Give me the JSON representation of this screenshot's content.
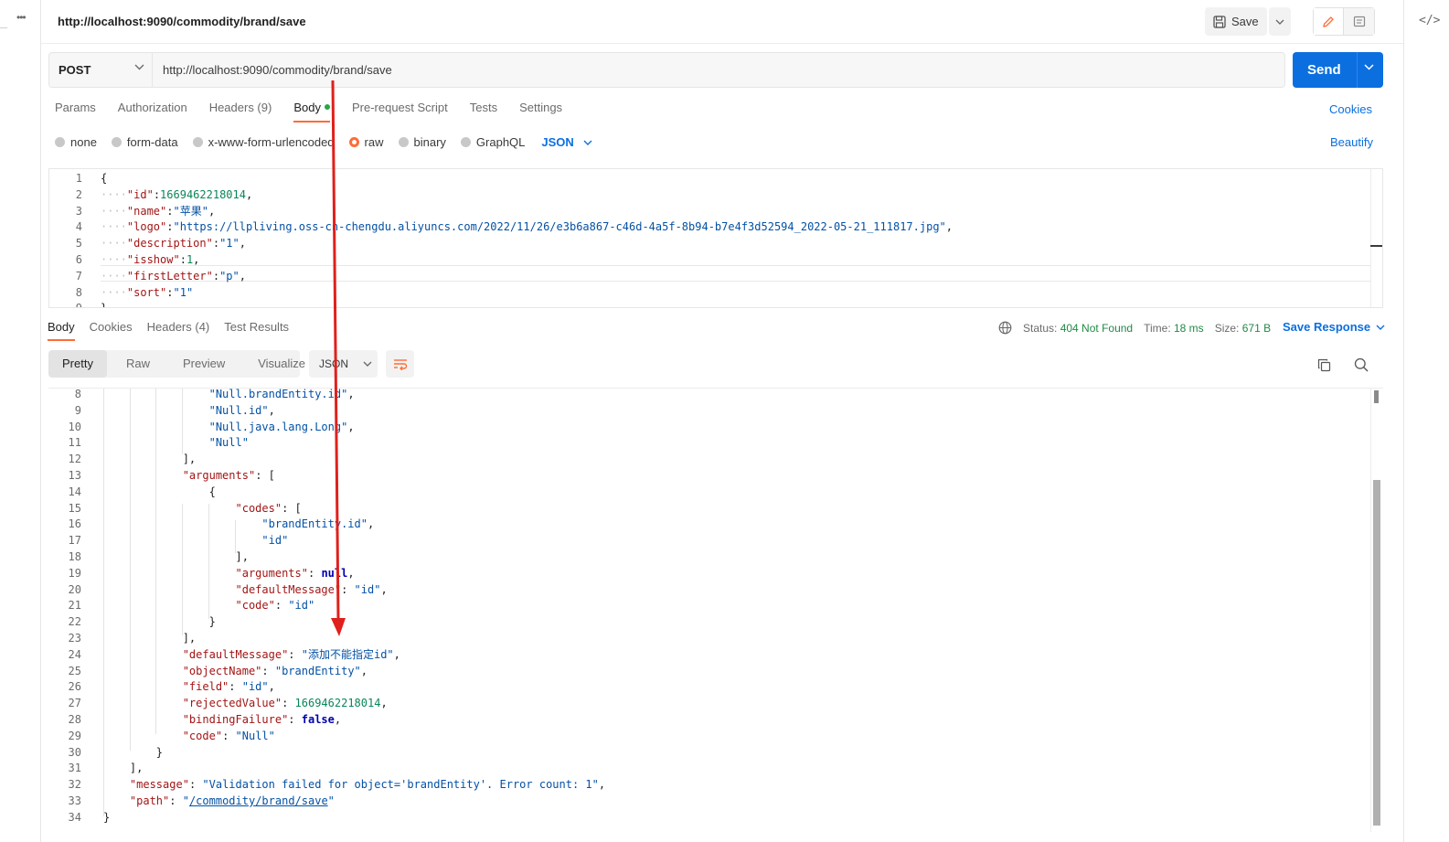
{
  "tab": {
    "title": "http://localhost:9090/commodity/brand/save",
    "save_label": "Save"
  },
  "request": {
    "method": "POST",
    "url": "http://localhost:9090/commodity/brand/save",
    "send_label": "Send",
    "tabs": [
      {
        "label": "Params"
      },
      {
        "label": "Authorization"
      },
      {
        "label": "Headers (9)"
      },
      {
        "label": "Body"
      },
      {
        "label": "Pre-request Script"
      },
      {
        "label": "Tests"
      },
      {
        "label": "Settings"
      }
    ],
    "cookies_label": "Cookies",
    "body_types": [
      "none",
      "form-data",
      "x-www-form-urlencoded",
      "raw",
      "binary",
      "GraphQL"
    ],
    "selected_body_type": "raw",
    "format": "JSON",
    "beautify_label": "Beautify",
    "body_lines": [
      {
        "n": "1",
        "text": "{"
      },
      {
        "n": "2",
        "ind": "····",
        "key": "\"id\"",
        "sep": ":",
        "val": "1669462218014",
        "vt": "n",
        "end": ","
      },
      {
        "n": "3",
        "ind": "····",
        "key": "\"name\"",
        "sep": ":",
        "val": "\"苹果\"",
        "vt": "s",
        "end": ","
      },
      {
        "n": "4",
        "ind": "····",
        "key": "\"logo\"",
        "sep": ":",
        "val": "\"https://llpliving.oss-cn-chengdu.aliyuncs.com/2022/11/26/e3b6a867-c46d-4a5f-8b94-b7e4f3d52594_2022-05-21_111817.jpg\"",
        "vt": "s",
        "end": ","
      },
      {
        "n": "5",
        "ind": "····",
        "key": "\"description\"",
        "sep": ":",
        "val": "\"1\"",
        "vt": "s",
        "end": ","
      },
      {
        "n": "6",
        "ind": "····",
        "key": "\"isshow\"",
        "sep": ":",
        "val": "1",
        "vt": "n",
        "end": ","
      },
      {
        "n": "7",
        "ind": "····",
        "key": "\"firstLetter\"",
        "sep": ":",
        "val": "\"p\"",
        "vt": "s",
        "end": ","
      },
      {
        "n": "8",
        "ind": "····",
        "key": "\"sort\"",
        "sep": ":",
        "val": "\"1\"",
        "vt": "s",
        "end": ""
      },
      {
        "n": "9",
        "text": "}"
      }
    ]
  },
  "response": {
    "tabs": [
      {
        "label": "Body"
      },
      {
        "label": "Cookies"
      },
      {
        "label": "Headers (4)"
      },
      {
        "label": "Test Results"
      }
    ],
    "status_label": "Status:",
    "status_value": "404 Not Found",
    "time_label": "Time:",
    "time_value": "18 ms",
    "size_label": "Size:",
    "size_value": "671 B",
    "save_response_label": "Save Response",
    "views": [
      "Pretty",
      "Raw",
      "Preview",
      "Visualize"
    ],
    "format": "JSON",
    "lines": [
      {
        "n": "8",
        "ind": "                ",
        "val": "\"Null.brandEntity.id\"",
        "vt": "s",
        "end": ","
      },
      {
        "n": "9",
        "ind": "                ",
        "val": "\"Null.id\"",
        "vt": "s",
        "end": ","
      },
      {
        "n": "10",
        "ind": "                ",
        "val": "\"Null.java.lang.Long\"",
        "vt": "s",
        "end": ","
      },
      {
        "n": "11",
        "ind": "                ",
        "val": "\"Null\"",
        "vt": "s",
        "end": ""
      },
      {
        "n": "12",
        "ind": "            ",
        "text": "],",
        "vt": "p"
      },
      {
        "n": "13",
        "ind": "            ",
        "key": "\"arguments\"",
        "sep": ": ",
        "text2": "["
      },
      {
        "n": "14",
        "ind": "                ",
        "text": "{",
        "vt": "p"
      },
      {
        "n": "15",
        "ind": "                    ",
        "key": "\"codes\"",
        "sep": ": ",
        "text2": "["
      },
      {
        "n": "16",
        "ind": "                        ",
        "val": "\"brandEntity.id\"",
        "vt": "s",
        "end": ","
      },
      {
        "n": "17",
        "ind": "                        ",
        "val": "\"id\"",
        "vt": "s",
        "end": ""
      },
      {
        "n": "18",
        "ind": "                    ",
        "text": "],",
        "vt": "p"
      },
      {
        "n": "19",
        "ind": "                    ",
        "key": "\"arguments\"",
        "sep": ": ",
        "val": "null",
        "vt": "b",
        "end": ","
      },
      {
        "n": "20",
        "ind": "                    ",
        "key": "\"defaultMessage\"",
        "sep": ": ",
        "val": "\"id\"",
        "vt": "s",
        "end": ","
      },
      {
        "n": "21",
        "ind": "                    ",
        "key": "\"code\"",
        "sep": ": ",
        "val": "\"id\"",
        "vt": "s",
        "end": ""
      },
      {
        "n": "22",
        "ind": "                ",
        "text": "}",
        "vt": "p"
      },
      {
        "n": "23",
        "ind": "            ",
        "text": "],",
        "vt": "p"
      },
      {
        "n": "24",
        "ind": "            ",
        "key": "\"defaultMessage\"",
        "sep": ": ",
        "val": "\"添加不能指定id\"",
        "vt": "s",
        "end": ","
      },
      {
        "n": "25",
        "ind": "            ",
        "key": "\"objectName\"",
        "sep": ": ",
        "val": "\"brandEntity\"",
        "vt": "s",
        "end": ","
      },
      {
        "n": "26",
        "ind": "            ",
        "key": "\"field\"",
        "sep": ": ",
        "val": "\"id\"",
        "vt": "s",
        "end": ","
      },
      {
        "n": "27",
        "ind": "            ",
        "key": "\"rejectedValue\"",
        "sep": ": ",
        "val": "1669462218014",
        "vt": "n",
        "end": ","
      },
      {
        "n": "28",
        "ind": "            ",
        "key": "\"bindingFailure\"",
        "sep": ": ",
        "val": "false",
        "vt": "b",
        "end": ","
      },
      {
        "n": "29",
        "ind": "            ",
        "key": "\"code\"",
        "sep": ": ",
        "val": "\"Null\"",
        "vt": "s",
        "end": ""
      },
      {
        "n": "30",
        "ind": "        ",
        "text": "}",
        "vt": "p"
      },
      {
        "n": "31",
        "ind": "    ",
        "text": "],",
        "vt": "p"
      },
      {
        "n": "32",
        "ind": "    ",
        "key": "\"message\"",
        "sep": ": ",
        "val": "\"Validation failed for object='brandEntity'. Error count: 1\"",
        "vt": "s",
        "end": ","
      },
      {
        "n": "33",
        "ind": "    ",
        "key": "\"path\"",
        "sep": ": ",
        "val": "\"/commodity/brand/save\"",
        "vt": "u",
        "end": ""
      },
      {
        "n": "34",
        "ind": "",
        "text": "}",
        "vt": "p"
      }
    ]
  },
  "colors": {
    "accent": "#ff6c37",
    "send": "#0b6fe0",
    "link": "#0b6fe0",
    "status_ok": "#1f8a46",
    "annotation_arrow": "#e0201b"
  },
  "icons": [
    "ellipsis-icon",
    "code-icon",
    "save-disk-icon",
    "chevron-down-icon",
    "pencil-icon",
    "comment-icon",
    "globe-icon",
    "wrap-lines-icon",
    "copy-icon",
    "search-icon"
  ]
}
